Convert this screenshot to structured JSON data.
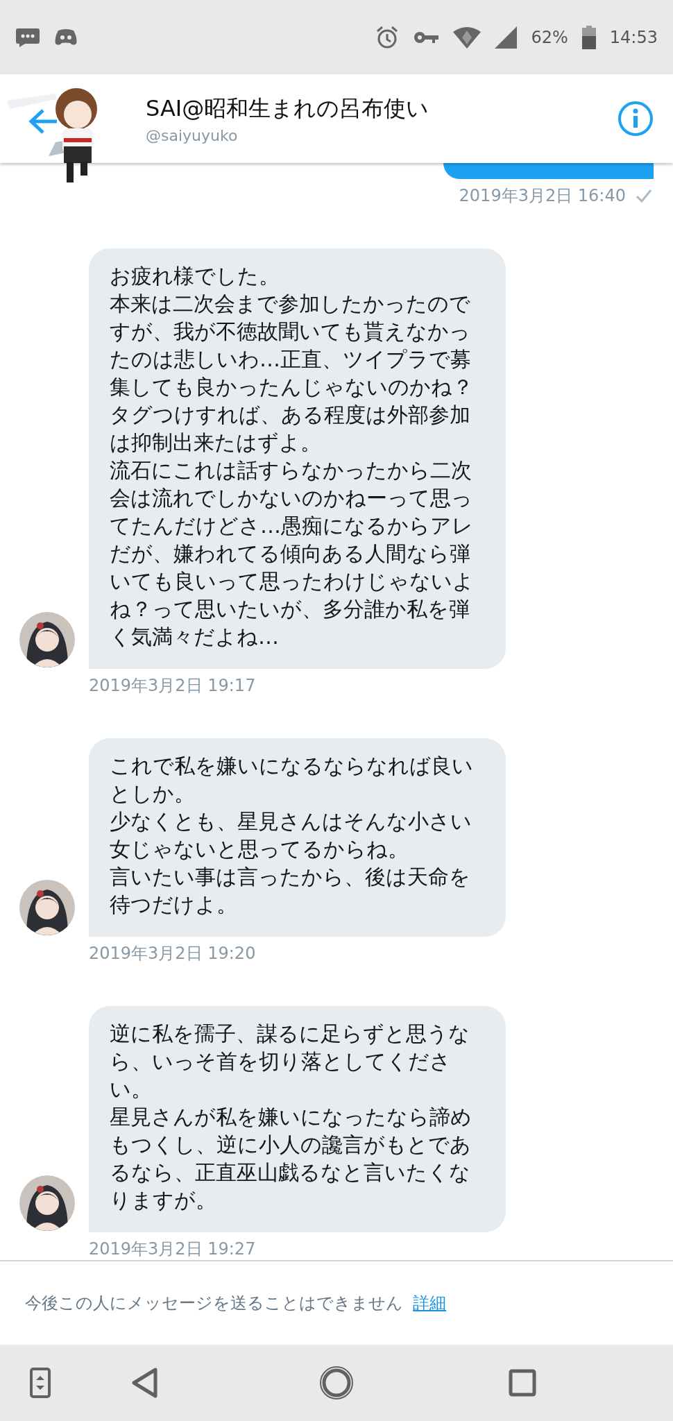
{
  "status_bar": {
    "battery": "62%",
    "time": "14:53"
  },
  "header": {
    "name": "SAI@昭和生まれの呂布使い",
    "handle": "@saiyuyuko"
  },
  "messages": [
    {
      "kind": "sent",
      "time": "2019年3月2日 16:40",
      "read": true
    },
    {
      "kind": "received",
      "paragraphs": [
        "お疲れ様でした。",
        "本来は二次会まで参加したかったのですが、我が不徳故聞いても貰えなかったのは悲しいわ…正直、ツイプラで募集しても良かったんじゃないのかね？タグつけすれば、ある程度は外部参加は抑制出来たはずよ。",
        "流石にこれは話すらなかったから二次会は流れでしかないのかねーって思ってたんだけどさ…愚痴になるからアレだが、嫌われてる傾向ある人間なら弾いても良いって思ったわけじゃないよね？って思いたいが、多分誰か私を弾く気満々だよね…"
      ],
      "time": "2019年3月2日 19:17"
    },
    {
      "kind": "received",
      "paragraphs": [
        "これで私を嫌いになるならなれば良いとしか。",
        "少なくとも、星見さんはそんな小さい女じゃないと思ってるからね。",
        "言いたい事は言ったから、後は天命を待つだけよ。"
      ],
      "time": "2019年3月2日 19:20"
    },
    {
      "kind": "received",
      "paragraphs": [
        "逆に私を孺子、謀るに足らずと思うなら、いっそ首を切り落としてください。",
        "星見さんが私を嫌いになったなら諦めもつくし、逆に小人の讒言がもとであるなら、正直巫山戯るなと言いたくなりますが。"
      ],
      "time": "2019年3月2日 19:27"
    }
  ],
  "footer": {
    "notice": "今後この人にメッセージを送ることはできません",
    "link": "詳細"
  }
}
